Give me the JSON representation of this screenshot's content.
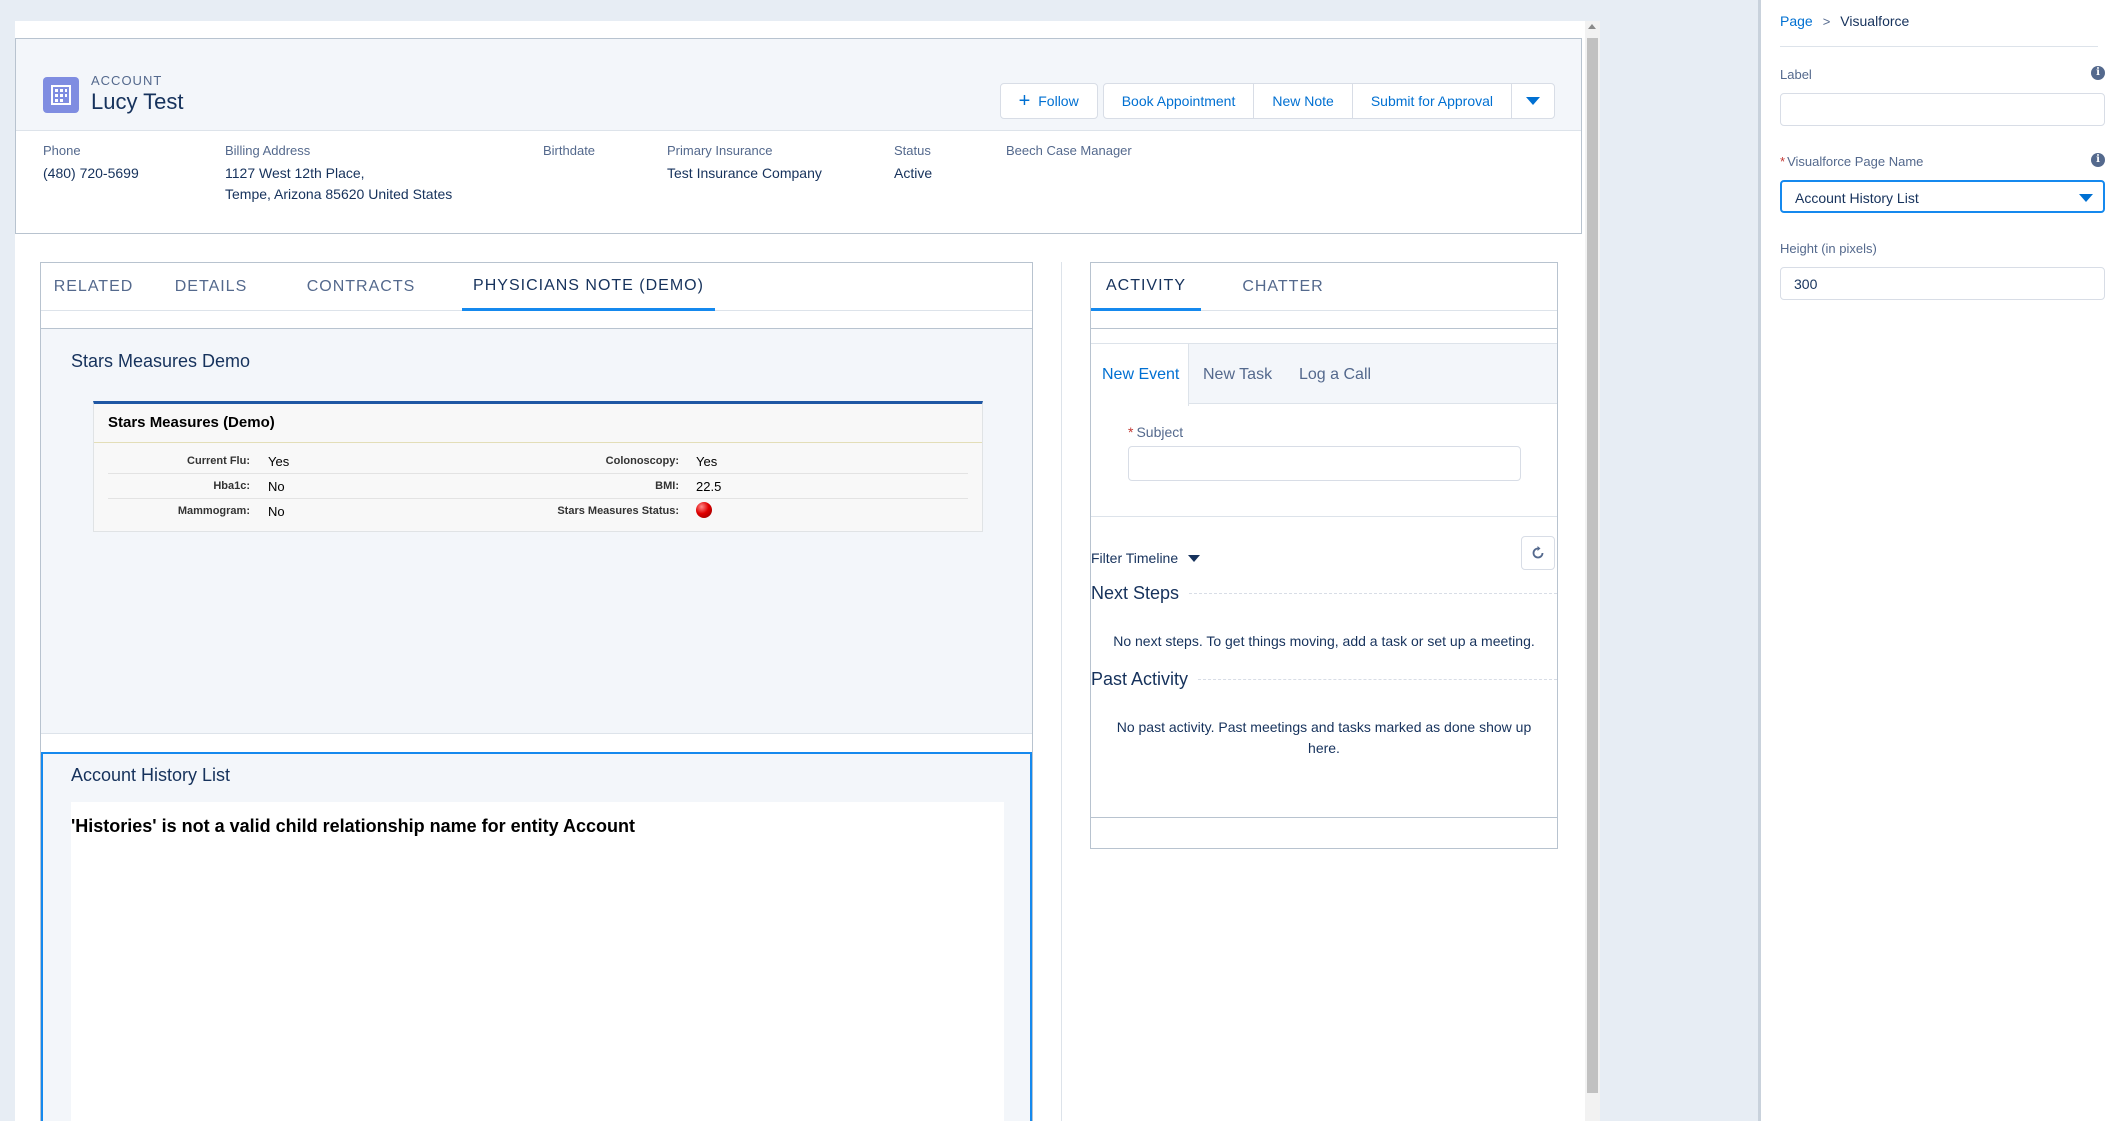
{
  "record": {
    "object_type": "ACCOUNT",
    "name": "Lucy Test",
    "actions": {
      "follow": "Follow",
      "book_appointment": "Book Appointment",
      "new_note": "New Note",
      "submit_for_approval": "Submit for Approval"
    },
    "fields": [
      {
        "label": "Phone",
        "value": "(480) 720-5699"
      },
      {
        "label": "Billing Address",
        "value_line1": "1127 West 12th Place,",
        "value_line2": "Tempe, Arizona 85620 United States"
      },
      {
        "label": "Birthdate",
        "value": ""
      },
      {
        "label": "Primary Insurance",
        "value": "Test Insurance Company"
      },
      {
        "label": "Status",
        "value": "Active"
      },
      {
        "label": "Beech Case Manager",
        "value": ""
      }
    ]
  },
  "tabs": [
    {
      "label": "RELATED"
    },
    {
      "label": "DETAILS"
    },
    {
      "label": "CONTRACTS"
    },
    {
      "label": "PHYSICIANS NOTE (DEMO)",
      "active": true
    }
  ],
  "stars_component": {
    "title": "Stars Measures Demo",
    "box_title": "Stars Measures (Demo)",
    "rows": [
      {
        "left_label": "Current Flu:",
        "left_value": "Yes",
        "right_label": "Colonoscopy:",
        "right_value": "Yes"
      },
      {
        "left_label": "Hba1c:",
        "left_value": "No",
        "right_label": "BMI:",
        "right_value": "22.5"
      },
      {
        "left_label": "Mammogram:",
        "left_value": "No",
        "right_label": "Stars Measures Status:",
        "right_value": ""
      }
    ],
    "status_color": "#e00000"
  },
  "history_component": {
    "title": "Account History List",
    "error": "'Histories' is not a valid child relationship name for entity Account"
  },
  "activity": {
    "tabs": [
      {
        "label": "ACTIVITY",
        "active": true
      },
      {
        "label": "CHATTER"
      }
    ],
    "publisher_tabs": [
      {
        "label": "New Event",
        "active": true
      },
      {
        "label": "New Task"
      },
      {
        "label": "Log a Call"
      }
    ],
    "subject_label": "Subject",
    "filter_timeline": "Filter Timeline",
    "next_steps_title": "Next Steps",
    "next_steps_empty": "No next steps. To get things moving, add a task or set up a meeting.",
    "past_activity_title": "Past Activity",
    "past_activity_empty_line1": "No past activity. Past meetings and tasks marked as done show up",
    "past_activity_empty_line2": "here."
  },
  "properties": {
    "breadcrumb": [
      "Page",
      "Visualforce"
    ],
    "label_field": {
      "label": "Label",
      "value": ""
    },
    "vf_page_name": {
      "label": "Visualforce Page Name",
      "value": "Account History List"
    },
    "height": {
      "label": "Height (in pixels)",
      "value": "300"
    }
  },
  "colors": {
    "brand": "#0070d2",
    "account_icon": "#7f8de1",
    "active_tab": "#1589ee",
    "required": "#c23934"
  }
}
